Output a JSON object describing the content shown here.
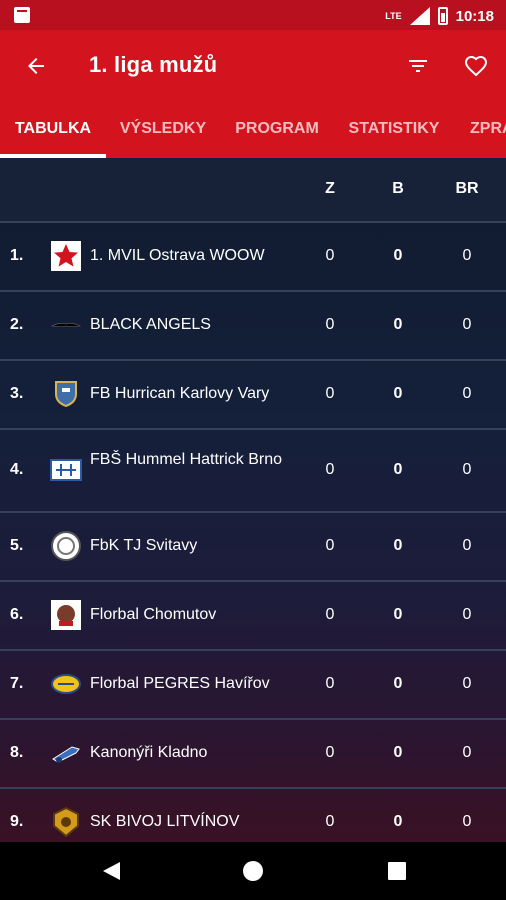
{
  "status": {
    "network": "LTE",
    "time": "10:18"
  },
  "appbar": {
    "title": "1. liga mužů"
  },
  "tabs": [
    "TABULKA",
    "VÝSLEDKY",
    "PROGRAM",
    "STATISTIKY",
    "ZPRÁ"
  ],
  "table": {
    "headers": [
      "Z",
      "B",
      "BR"
    ],
    "rows": [
      {
        "rank": "1.",
        "team": "1. MVIL Ostrava WOOW",
        "z": "0",
        "b": "0",
        "br": "0"
      },
      {
        "rank": "2.",
        "team": "BLACK ANGELS",
        "z": "0",
        "b": "0",
        "br": "0"
      },
      {
        "rank": "3.",
        "team": "FB Hurrican Karlovy Vary",
        "z": "0",
        "b": "0",
        "br": "0"
      },
      {
        "rank": "4.",
        "team": "FBŠ Hummel Hattrick Brno",
        "z": "0",
        "b": "0",
        "br": "0"
      },
      {
        "rank": "5.",
        "team": "FbK TJ Svitavy",
        "z": "0",
        "b": "0",
        "br": "0"
      },
      {
        "rank": "6.",
        "team": "Florbal Chomutov",
        "z": "0",
        "b": "0",
        "br": "0"
      },
      {
        "rank": "7.",
        "team": "Florbal PEGRES Havířov",
        "z": "0",
        "b": "0",
        "br": "0"
      },
      {
        "rank": "8.",
        "team": "Kanonýři Kladno",
        "z": "0",
        "b": "0",
        "br": "0"
      },
      {
        "rank": "9.",
        "team": "SK BIVOJ LITVÍNOV",
        "z": "0",
        "b": "0",
        "br": "0"
      }
    ]
  },
  "colors": {
    "statusbar": "#b9101f",
    "appbar": "#d3141f",
    "background": "#101a2e"
  }
}
